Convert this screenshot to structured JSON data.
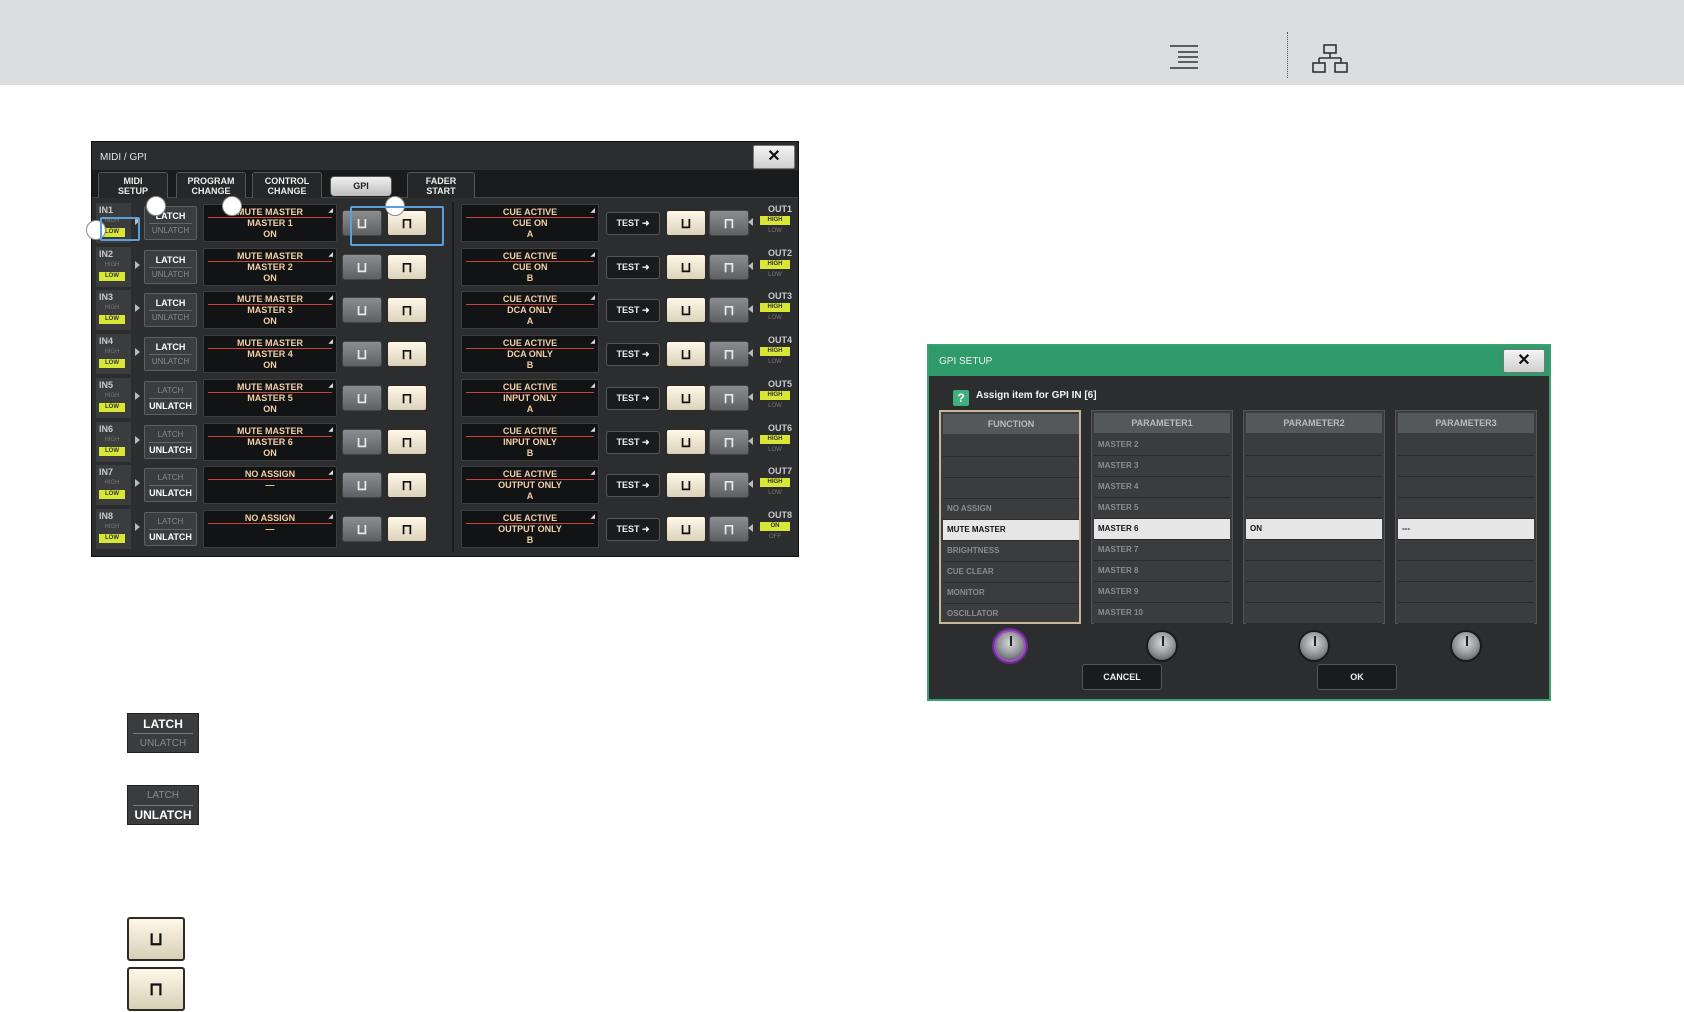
{
  "midi_gpi": {
    "title": "MIDI / GPI",
    "close": "✕",
    "tabs": [
      {
        "label": "MIDI\nSETUP"
      },
      {
        "label": "PROGRAM\nCHANGE"
      },
      {
        "label": "CONTROL\nCHANGE"
      },
      {
        "label": "GPI"
      },
      {
        "label": "FADER\nSTART"
      }
    ],
    "high": "HIGH",
    "low": "LOW",
    "latch": "LATCH",
    "unlatch": "UNLATCH",
    "test": "TEST ➜",
    "inputs": [
      {
        "id": "IN1",
        "latch": true,
        "l1": "MUTE MASTER",
        "l2": "MASTER 1",
        "l3": "ON"
      },
      {
        "id": "IN2",
        "latch": true,
        "l1": "MUTE MASTER",
        "l2": "MASTER 2",
        "l3": "ON"
      },
      {
        "id": "IN3",
        "latch": true,
        "l1": "MUTE MASTER",
        "l2": "MASTER 3",
        "l3": "ON"
      },
      {
        "id": "IN4",
        "latch": true,
        "l1": "MUTE MASTER",
        "l2": "MASTER 4",
        "l3": "ON"
      },
      {
        "id": "IN5",
        "latch": false,
        "l1": "MUTE MASTER",
        "l2": "MASTER 5",
        "l3": "ON"
      },
      {
        "id": "IN6",
        "latch": false,
        "l1": "MUTE MASTER",
        "l2": "MASTER 6",
        "l3": "ON"
      },
      {
        "id": "IN7",
        "latch": false,
        "l1": "NO ASSIGN",
        "l2": "—",
        "l3": ""
      },
      {
        "id": "IN8",
        "latch": false,
        "l1": "NO ASSIGN",
        "l2": "—",
        "l3": ""
      }
    ],
    "outputs": [
      {
        "id": "OUT1",
        "l1": "CUE ACTIVE",
        "l2": "CUE ON",
        "l3": "A",
        "hi": "HIGH",
        "lo": "LOW"
      },
      {
        "id": "OUT2",
        "l1": "CUE ACTIVE",
        "l2": "CUE ON",
        "l3": "B",
        "hi": "HIGH",
        "lo": "LOW"
      },
      {
        "id": "OUT3",
        "l1": "CUE ACTIVE",
        "l2": "DCA ONLY",
        "l3": "A",
        "hi": "HIGH",
        "lo": "LOW"
      },
      {
        "id": "OUT4",
        "l1": "CUE ACTIVE",
        "l2": "DCA ONLY",
        "l3": "B",
        "hi": "HIGH",
        "lo": "LOW"
      },
      {
        "id": "OUT5",
        "l1": "CUE ACTIVE",
        "l2": "INPUT ONLY",
        "l3": "A",
        "hi": "HIGH",
        "lo": "LOW"
      },
      {
        "id": "OUT6",
        "l1": "CUE ACTIVE",
        "l2": "INPUT ONLY",
        "l3": "B",
        "hi": "HIGH",
        "lo": "LOW"
      },
      {
        "id": "OUT7",
        "l1": "CUE ACTIVE",
        "l2": "OUTPUT ONLY",
        "l3": "A",
        "hi": "HIGH",
        "lo": "LOW"
      },
      {
        "id": "OUT8",
        "l1": "CUE ACTIVE",
        "l2": "OUTPUT ONLY",
        "l3": "B",
        "hi": "ON",
        "lo": "OFF"
      }
    ],
    "pol_falling": "⊔",
    "pol_rising": "⊓"
  },
  "legend": {
    "latch": "LATCH",
    "unlatch": "UNLATCH",
    "falling": "⊔",
    "rising": "⊓"
  },
  "gpi_setup": {
    "title": "GPI SETUP",
    "close": "✕",
    "help": "?",
    "prompt": "Assign item for GPI IN [6]",
    "columns": [
      {
        "head": "FUNCTION",
        "items": [
          "",
          "",
          "",
          "NO ASSIGN",
          "MUTE MASTER",
          "BRIGHTNESS",
          "CUE CLEAR",
          "MONITOR",
          "OSCILLATOR"
        ],
        "selected": 4
      },
      {
        "head": "PARAMETER1",
        "items": [
          "MASTER 2",
          "MASTER 3",
          "MASTER 4",
          "MASTER 5",
          "MASTER 6",
          "MASTER 7",
          "MASTER 8",
          "MASTER 9",
          "MASTER 10"
        ],
        "selected": 4
      },
      {
        "head": "PARAMETER2",
        "items": [
          "",
          "",
          "",
          "",
          "ON",
          "",
          "",
          "",
          ""
        ],
        "selected": 4
      },
      {
        "head": "PARAMETER3",
        "items": [
          "",
          "",
          "",
          "",
          "---",
          "",
          "",
          "",
          ""
        ],
        "selected": 4
      }
    ],
    "cancel": "CANCEL",
    "ok": "OK"
  }
}
